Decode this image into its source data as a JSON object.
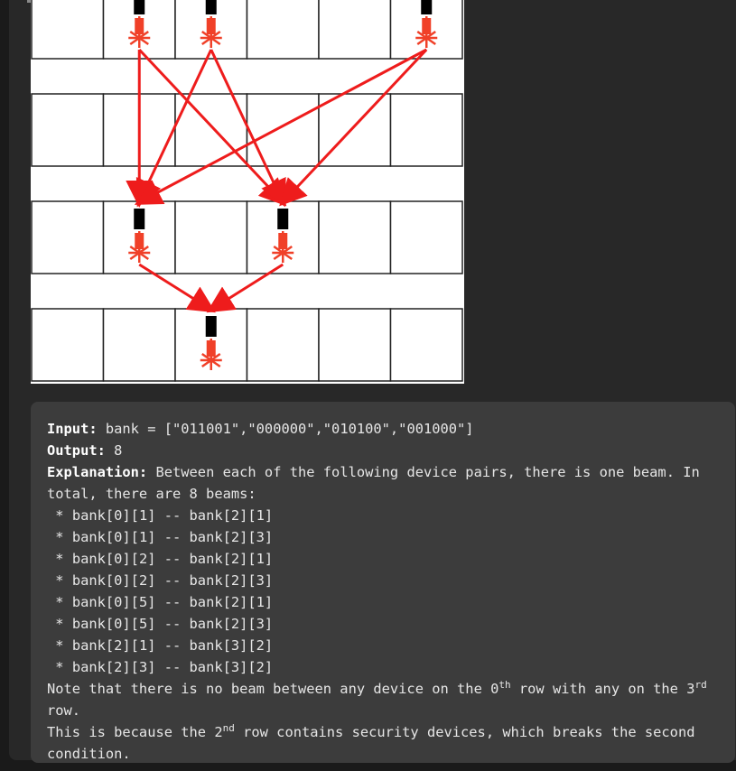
{
  "diagram": {
    "rows": 4,
    "cols": 6,
    "device_rows": [
      [
        1,
        2,
        5
      ],
      [],
      [
        1,
        3
      ],
      [
        2
      ]
    ],
    "beam_color": "#ee1c1c",
    "device_color": "#000000",
    "laser_color": "#f04028"
  },
  "example": {
    "input_label": "Input:",
    "input_value": " bank = [\"011001\",\"000000\",\"010100\",\"001000\"]",
    "output_label": "Output:",
    "output_value": " 8",
    "explanation_label": "Explanation:",
    "explanation_text": " Between each of the following device pairs, there is one beam. In total, there are 8 beams:",
    "pairs": [
      " * bank[0][1] -- bank[2][1]",
      " * bank[0][1] -- bank[2][3]",
      " * bank[0][2] -- bank[2][1]",
      " * bank[0][2] -- bank[2][3]",
      " * bank[0][5] -- bank[2][1]",
      " * bank[0][5] -- bank[2][3]",
      " * bank[2][1] -- bank[3][2]",
      " * bank[2][3] -- bank[3][2]"
    ],
    "note_pre": "Note that there is no beam between any device on the 0",
    "note_sup1": "th",
    "note_mid": " row with any on the 3",
    "note_sup2": "rd",
    "note_post": " row.",
    "reason_pre": "This is because the 2",
    "reason_sup": "nd",
    "reason_post": " row contains security devices, which breaks the second condition."
  }
}
